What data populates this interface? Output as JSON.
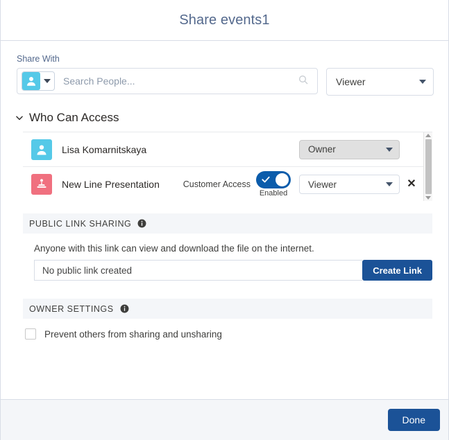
{
  "header": {
    "title": "Share events1"
  },
  "share_with": {
    "label": "Share With",
    "type_icon": "person-icon",
    "search_placeholder": "Search People...",
    "search_value": "",
    "search_icon": "search-icon",
    "role": "Viewer"
  },
  "who_can_access": {
    "title": "Who Can Access",
    "chevron_icon": "chevron-down-icon",
    "rows": [
      {
        "avatar_icon": "person-avatar-icon",
        "avatar_color": "#55c9e8",
        "name": "Lisa Komarnitskaya",
        "has_customer_access": false,
        "customer_access_label": "",
        "toggle_label": "",
        "role": "Owner",
        "role_disabled": true,
        "removable": false,
        "remove_icon": "close-icon"
      },
      {
        "avatar_icon": "presentation-avatar-icon",
        "avatar_color": "#f0707f",
        "name": "New Line Presentation",
        "has_customer_access": true,
        "customer_access_label": "Customer Access",
        "toggle_label": "Enabled",
        "toggle_on": true,
        "role": "Viewer",
        "role_disabled": false,
        "removable": true,
        "remove_icon": "close-icon"
      }
    ],
    "scrollbar": {
      "up_icon": "scroll-up-arrow-icon",
      "down_icon": "scroll-down-arrow-icon"
    }
  },
  "public_link_sharing": {
    "section_title": "PUBLIC LINK SHARING",
    "info_icon": "info-icon",
    "description": "Anyone with this link can view and download the file on the internet.",
    "link_value": "",
    "link_placeholder": "No public link created",
    "create_button": "Create Link"
  },
  "owner_settings": {
    "section_title": "OWNER SETTINGS",
    "info_icon": "info-icon",
    "checkbox_label": "Prevent others from sharing and unsharing",
    "checkbox_checked": false
  },
  "footer": {
    "done_label": "Done"
  },
  "colors": {
    "primary": "#1b5297",
    "toggle_on": "#0b5cab",
    "title": "#54698d",
    "section_bg": "#f4f6f9",
    "border": "#d8dde6"
  }
}
